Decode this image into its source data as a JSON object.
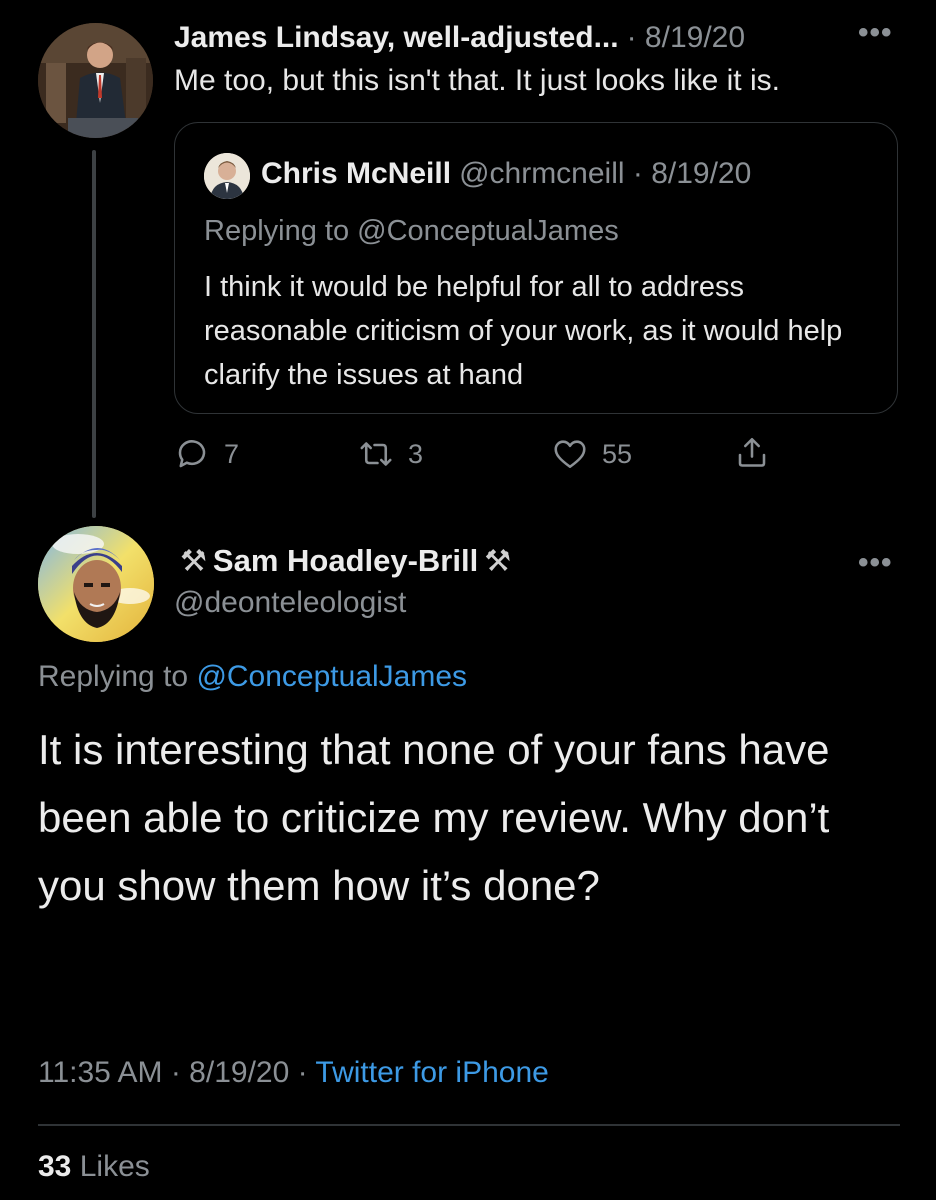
{
  "reply_context": {
    "author_name": "James Lindsay, well-adjusted...",
    "date": "· 8/19/20",
    "more": "•••",
    "text": "Me too, but this isn't that. It just looks like it is.",
    "quote": {
      "author_name": "Chris McNeill",
      "handle_date": "@chrmcneill · 8/19/20",
      "replying_to": "Replying to @ConceptualJames",
      "text": "I think it would be helpful for all to address reasonable criticism of your work, as it would help clarify the issues at hand"
    },
    "actions": {
      "reply_count": "7",
      "retweet_count": "3",
      "like_count": "55"
    }
  },
  "main_tweet": {
    "author_name": "Sam Hoadley-Brill",
    "name_emoji": "⚒",
    "handle": "@deonteleologist",
    "more": "•••",
    "replying_prefix": "Replying to",
    "replying_handle": "@ConceptualJames",
    "text": "It is interesting that none of your fans have been able to criticize my review. Why don’t you show them how it’s done?",
    "time_date": "11:35 AM · 8/19/20 ·",
    "source": "Twitter for iPhone",
    "likes_count": "33",
    "likes_label": "Likes"
  },
  "colors": {
    "background": "#000000",
    "secondary_text": "#8b9095",
    "link": "#3d9ae5",
    "border": "#2f3336"
  }
}
